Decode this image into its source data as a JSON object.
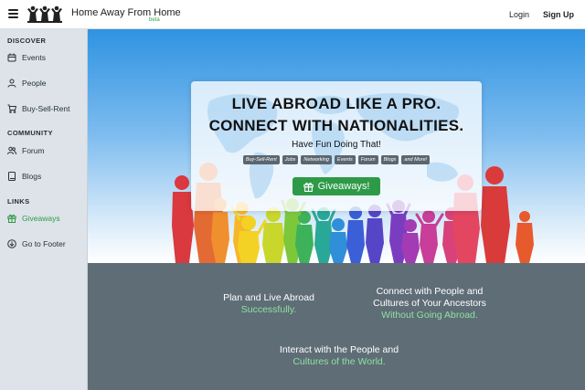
{
  "header": {
    "brand": "Home Away From Home",
    "beta": "beta",
    "login": "Login",
    "signup": "Sign Up"
  },
  "sidebar": {
    "discover_title": "DISCOVER",
    "community_title": "COMMUNITY",
    "links_title": "LINKS",
    "items": [
      {
        "label": "Events",
        "icon": "calendar-icon"
      },
      {
        "label": "People",
        "icon": "person-icon"
      },
      {
        "label": "Buy-Sell-Rent",
        "icon": "cart-icon"
      },
      {
        "label": "Forum",
        "icon": "users-icon"
      },
      {
        "label": "Blogs",
        "icon": "book-icon"
      },
      {
        "label": "Giveaways",
        "icon": "gift-icon"
      },
      {
        "label": "Go to Footer",
        "icon": "arrow-down-circle-icon"
      }
    ]
  },
  "hero": {
    "line1": "LIVE ABROAD LIKE A PRO.",
    "line2": "CONNECT WITH NATIONALITIES.",
    "subtitle": "Have Fun Doing That!",
    "tags": [
      "Buy-Sell-Rent",
      "Jobs",
      "Networking",
      "Events",
      "Forum",
      "Blogs",
      "and More!"
    ],
    "button": "Giveaways!"
  },
  "features": {
    "f1_line1": "Plan and Live Abroad",
    "f1_green": "Successfully.",
    "f2_line1": "Connect with People and",
    "f2_line2": "Cultures of Your Ancestors",
    "f2_green": "Without Going Abroad.",
    "f3_line1": "Interact with the People and",
    "f3_green": "Cultures of the World."
  },
  "colors": {
    "accent_green": "#2e9a48",
    "sidebar_bg": "#dde3e9",
    "lower_bg": "#5f6d77"
  }
}
